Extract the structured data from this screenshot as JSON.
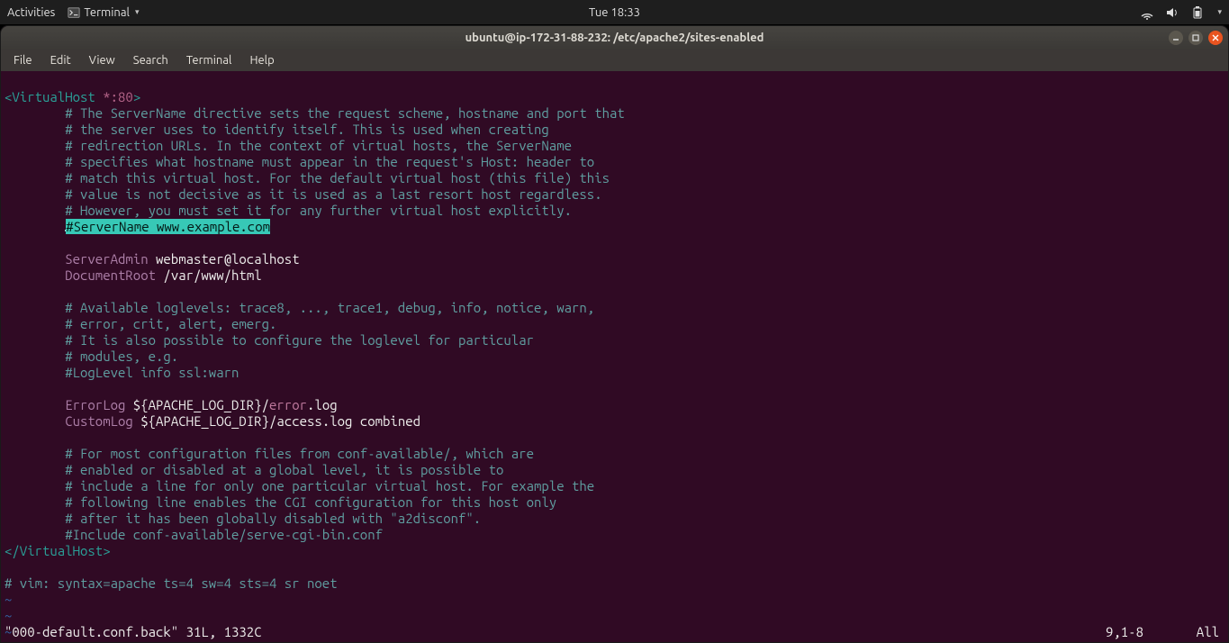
{
  "topbar": {
    "activities": "Activities",
    "appmenu": "Terminal",
    "clock": "Tue 18:33"
  },
  "window": {
    "title": "ubuntu@ip-172-31-88-232: /etc/apache2/sites-enabled"
  },
  "menubar": [
    "File",
    "Edit",
    "View",
    "Search",
    "Terminal",
    "Help"
  ],
  "vim": {
    "l1_a": "<VirtualHost",
    "l1_b": "*:80",
    "l1_c": ">",
    "c1": "        # The ServerName directive sets the request scheme, hostname and port that",
    "c2": "        # the server uses to identify itself. This is used when creating",
    "c3": "        # redirection URLs. In the context of virtual hosts, the ServerName",
    "c4": "        # specifies what hostname must appear in the request's Host: header to",
    "c5": "        # match this virtual host. For the default virtual host (this file) this",
    "c6": "        # value is not decisive as it is used as a last resort host regardless.",
    "c7": "        # However, you must set it for any further virtual host explicitly.",
    "sel_pre": "        ",
    "sel": "#ServerName www.example.com",
    "sa_kw": "ServerAdmin",
    "sa_val": " webmaster@localhost",
    "dr_kw": "DocumentRoot",
    "dr_val": " /var/www/html",
    "c8": "        # Available loglevels: trace8, ..., trace1, debug, info, notice, warn,",
    "c9": "        # error, crit, alert, emerg.",
    "c10": "        # It is also possible to configure the loglevel for particular",
    "c11": "        # modules, e.g.",
    "c12": "        #LogLevel info ssl:warn",
    "el_kw": "ErrorLog",
    "el_v1": " ${APACHE_LOG_DIR}/",
    "el_v2": "error",
    "el_v3": ".log",
    "cl_kw": "CustomLog",
    "cl_val": " ${APACHE_LOG_DIR}/access.log combined",
    "c13": "        # For most configuration files from conf-available/, which are",
    "c14": "        # enabled or disabled at a global level, it is possible to",
    "c15": "        # include a line for only one particular virtual host. For example the",
    "c16": "        # following line enables the CGI configuration for this host only",
    "c17": "        # after it has been globally disabled with \"a2disconf\".",
    "c18": "        #Include conf-available/serve-cgi-bin.conf",
    "l_end": "</VirtualHost>",
    "c19": "# vim: syntax=apache ts=4 sw=4 sts=4 sr noet",
    "tilde": "~",
    "status_left": "\"000-default.conf.back\" 31L, 1332C",
    "status_mid": "9,1-8",
    "status_right": "All"
  }
}
